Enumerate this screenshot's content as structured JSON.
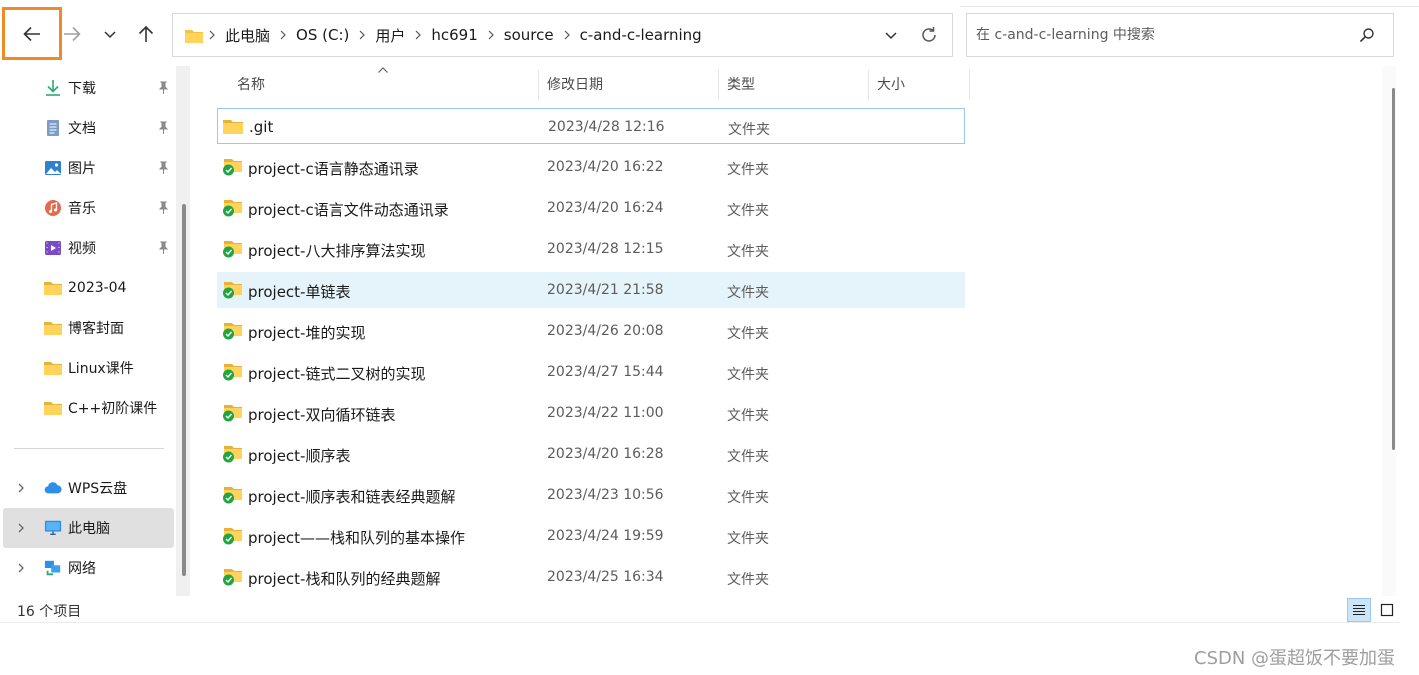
{
  "toolbar": {
    "back_icon": "arrow-left-icon",
    "forward_icon": "arrow-right-icon",
    "recent_icon": "chevron-down-icon",
    "up_icon": "arrow-up-icon",
    "highlight_color": "#f08a24"
  },
  "address": {
    "crumbs": [
      "此电脑",
      "OS (C:)",
      "用户",
      "hc691",
      "source",
      "c-and-c-learning"
    ]
  },
  "search": {
    "placeholder": "在 c-and-c-learning 中搜索"
  },
  "sidebar": {
    "quick_access": [
      {
        "label": "下载",
        "icon": "download-icon",
        "pinned": true
      },
      {
        "label": "文档",
        "icon": "document-icon",
        "pinned": true
      },
      {
        "label": "图片",
        "icon": "picture-icon",
        "pinned": true
      },
      {
        "label": "音乐",
        "icon": "music-icon",
        "pinned": true
      },
      {
        "label": "视频",
        "icon": "video-icon",
        "pinned": true
      },
      {
        "label": "2023-04",
        "icon": "folder-icon",
        "pinned": false
      },
      {
        "label": "博客封面",
        "icon": "folder-icon",
        "pinned": false
      },
      {
        "label": "Linux课件",
        "icon": "folder-icon",
        "pinned": false
      },
      {
        "label": "C++初阶课件",
        "icon": "folder-icon",
        "pinned": false
      }
    ],
    "locations": [
      {
        "label": "WPS云盘",
        "icon": "cloud-icon",
        "selected": false
      },
      {
        "label": "此电脑",
        "icon": "monitor-icon",
        "selected": true
      },
      {
        "label": "网络",
        "icon": "network-icon",
        "selected": false
      }
    ]
  },
  "columns": {
    "name": "名称",
    "date": "修改日期",
    "type": "类型",
    "size": "大小"
  },
  "files": [
    {
      "name": ".git",
      "date": "2023/4/28 12:16",
      "type": "文件夹",
      "synced": false,
      "state": "focused"
    },
    {
      "name": "project-c语言静态通讯录",
      "date": "2023/4/20 16:22",
      "type": "文件夹",
      "synced": true,
      "state": ""
    },
    {
      "name": "project-c语言文件动态通讯录",
      "date": "2023/4/20 16:24",
      "type": "文件夹",
      "synced": true,
      "state": ""
    },
    {
      "name": "project-八大排序算法实现",
      "date": "2023/4/28 12:15",
      "type": "文件夹",
      "synced": true,
      "state": ""
    },
    {
      "name": "project-单链表",
      "date": "2023/4/21 21:58",
      "type": "文件夹",
      "synced": true,
      "state": "hover"
    },
    {
      "name": "project-堆的实现",
      "date": "2023/4/26 20:08",
      "type": "文件夹",
      "synced": true,
      "state": ""
    },
    {
      "name": "project-链式二叉树的实现",
      "date": "2023/4/27 15:44",
      "type": "文件夹",
      "synced": true,
      "state": ""
    },
    {
      "name": "project-双向循环链表",
      "date": "2023/4/22 11:00",
      "type": "文件夹",
      "synced": true,
      "state": ""
    },
    {
      "name": "project-顺序表",
      "date": "2023/4/20 16:28",
      "type": "文件夹",
      "synced": true,
      "state": ""
    },
    {
      "name": "project-顺序表和链表经典题解",
      "date": "2023/4/23 10:56",
      "type": "文件夹",
      "synced": true,
      "state": ""
    },
    {
      "name": "project——栈和队列的基本操作",
      "date": "2023/4/24 19:59",
      "type": "文件夹",
      "synced": true,
      "state": ""
    },
    {
      "name": "project-栈和队列的经典题解",
      "date": "2023/4/25 16:34",
      "type": "文件夹",
      "synced": true,
      "state": ""
    }
  ],
  "status": {
    "item_count": "16 个项目"
  },
  "views": {
    "details_icon": "details-view-icon",
    "tiles_icon": "large-icons-view-icon"
  },
  "watermark": "CSDN @蛋超饭不要加蛋"
}
